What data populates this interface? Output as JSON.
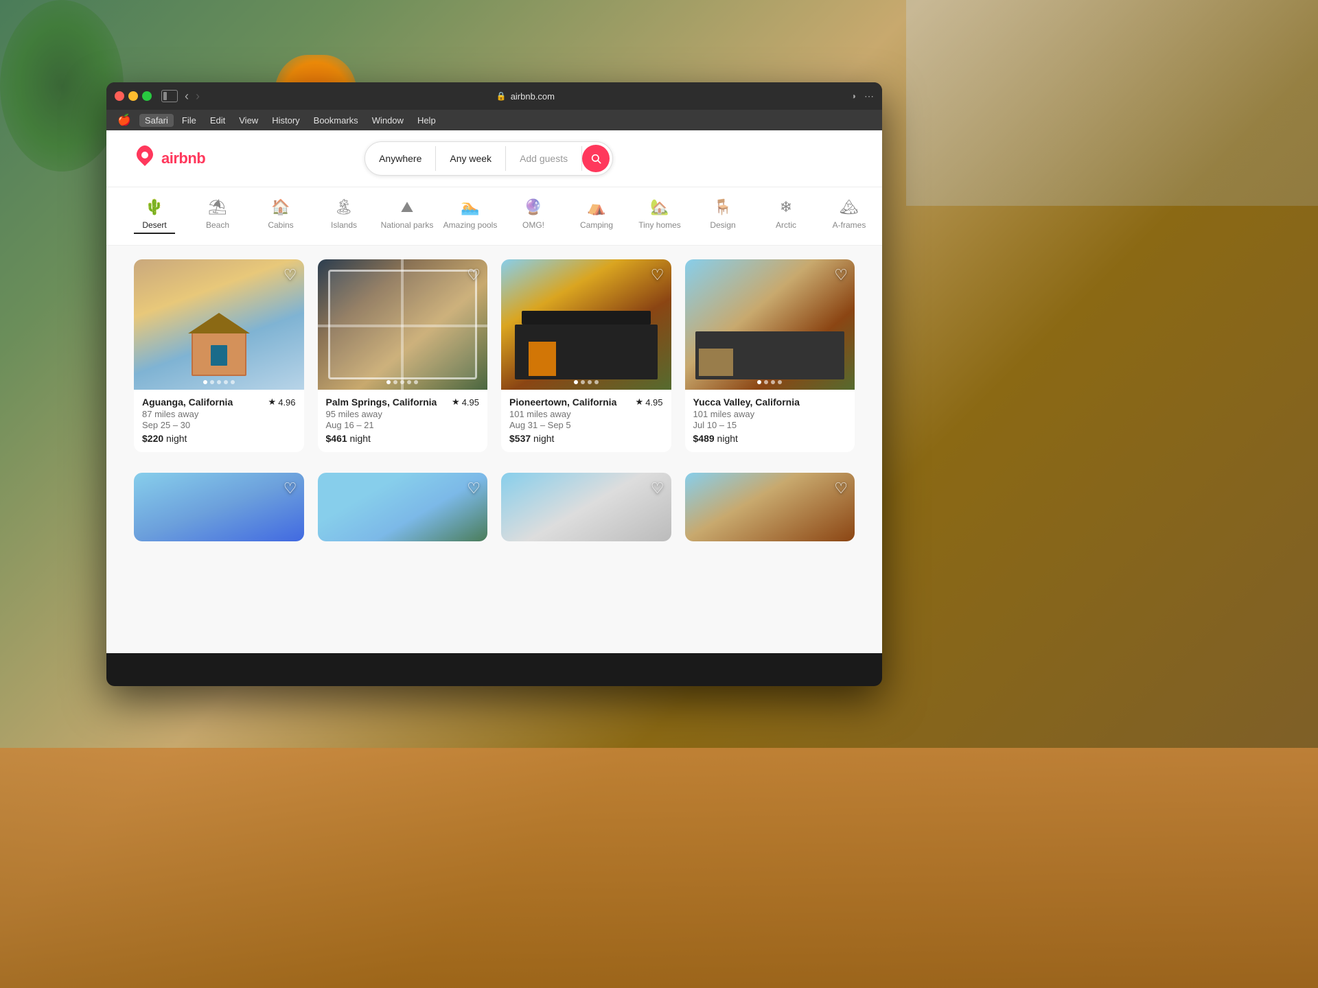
{
  "browser": {
    "url": "airbnb.com",
    "menuItems": [
      "Safari",
      "File",
      "Edit",
      "View",
      "History",
      "Bookmarks",
      "Window",
      "Help"
    ]
  },
  "header": {
    "logo": "airbnb",
    "logoSymbol": "✦",
    "search": {
      "anywhere": "Anywhere",
      "anyweek": "Any week",
      "addGuests": "Add guests"
    }
  },
  "categories": [
    {
      "id": "desert",
      "label": "Desert",
      "icon": "🌵",
      "active": true
    },
    {
      "id": "beach",
      "label": "Beach",
      "icon": "⛱"
    },
    {
      "id": "cabins",
      "label": "Cabins",
      "icon": "🏠"
    },
    {
      "id": "islands",
      "label": "Islands",
      "icon": "🏝"
    },
    {
      "id": "national-parks",
      "label": "National parks",
      "icon": "⛰"
    },
    {
      "id": "amazing-pools",
      "label": "Amazing pools",
      "icon": "🏊"
    },
    {
      "id": "omg",
      "label": "OMG!",
      "icon": "🔮"
    },
    {
      "id": "camping",
      "label": "Camping",
      "icon": "⛺"
    },
    {
      "id": "tiny-homes",
      "label": "Tiny homes",
      "icon": "🏡"
    },
    {
      "id": "design",
      "label": "Design",
      "icon": "🪑"
    },
    {
      "id": "arctic",
      "label": "Arctic",
      "icon": "❄"
    },
    {
      "id": "a-frames",
      "label": "A-frames",
      "icon": "🏔"
    }
  ],
  "listings": [
    {
      "id": 1,
      "location": "Aguanga, California",
      "distance": "87 miles away",
      "dates": "Sep 25 – 30",
      "price": "$220",
      "rating": "4.96",
      "imgClass": "img-aguanga",
      "dots": [
        true,
        false,
        false,
        false,
        false
      ]
    },
    {
      "id": 2,
      "location": "Palm Springs, California",
      "distance": "95 miles away",
      "dates": "Aug 16 – 21",
      "price": "$461",
      "rating": "4.95",
      "imgClass": "img-palmsprings",
      "dots": [
        true,
        false,
        false,
        false,
        false
      ]
    },
    {
      "id": 3,
      "location": "Pioneertown, California",
      "distance": "101 miles away",
      "dates": "Aug 31 – Sep 5",
      "price": "$537",
      "rating": "4.95",
      "imgClass": "img-pioneertown",
      "dots": [
        true,
        false,
        false,
        false
      ]
    },
    {
      "id": 4,
      "location": "Yucca Valley, California",
      "distance": "101 miles away",
      "dates": "Jul 10 – 15",
      "price": "$489",
      "rating": "",
      "imgClass": "img-yucca",
      "dots": [
        true,
        false,
        false,
        false
      ]
    }
  ],
  "row2listings": [
    {
      "id": 5,
      "imgClass": "img-row2-1"
    },
    {
      "id": 6,
      "imgClass": "img-row2-2"
    },
    {
      "id": 7,
      "imgClass": "img-row2-3"
    },
    {
      "id": 8,
      "imgClass": "img-row2-4"
    }
  ],
  "labels": {
    "night": "night",
    "searchIcon": "🔍"
  }
}
